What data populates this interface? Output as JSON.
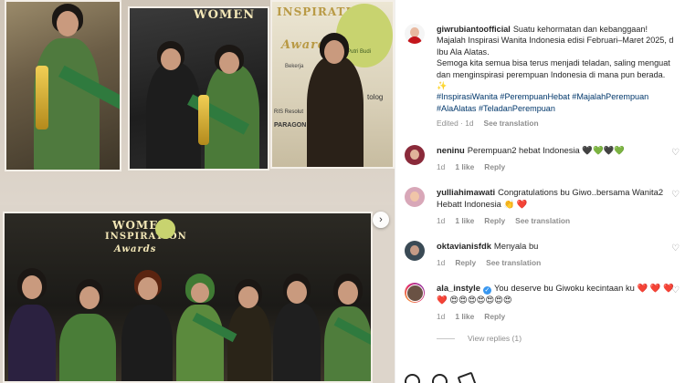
{
  "post": {
    "author": "giwrubiantoofficial",
    "caption_lines": [
      "Suatu kehormatan dan kebanggaan!",
      "Majalah Inspirasi Wanita Indonesia edisi Februari–Maret 2025, d",
      "Ibu Ala Alatas.",
      "Semoga kita semua bisa terus menjadi teladan, saling menguat",
      "dan menginspirasi perempuan Indonesia di mana pun berada.",
      "✨"
    ],
    "hashtags_line1": "#InspirasiWanita #PerempuanHebat #MajalahPerempuan",
    "hashtags_line2": "#AlaAlatas #TeladanPerempuan",
    "edited": "Edited · 1d",
    "see_translation": "See translation"
  },
  "photo": {
    "banner_top": "WOMEN",
    "banner_top2": "INSPIRATION",
    "banner_award": "Awards",
    "banner_bottom": "WOMEN",
    "banner_bottom2": "INSPIRATION",
    "banner_bottom_award": "Awards",
    "sponsor1": "Bekerja",
    "sponsor2": "RIS Resolut",
    "sponsor3": "PARAGON",
    "sponsor4": "tolog",
    "logo_text": "Putri Budi",
    "next_icon": "chevron-right-icon"
  },
  "comments": [
    {
      "user": "neninu",
      "text": "Perempuan2 hebat Indonesia 🖤💚🖤💚",
      "time": "1d",
      "likes": "1 like",
      "reply": "Reply",
      "translate": ""
    },
    {
      "user": "yulliahimawati",
      "text": "Congratulations bu Giwo..bersama Wanita2 Hebatt Indonesia 👏 ❤️",
      "time": "1d",
      "likes": "1 like",
      "reply": "Reply",
      "translate": "See translation"
    },
    {
      "user": "oktavianisfdk",
      "text": "Menyala bu",
      "time": "1d",
      "likes": "",
      "reply": "Reply",
      "translate": "See translation"
    },
    {
      "user": "ala_instyle",
      "text": "You deserve bu Giwoku kecintaan ku ❤️ ❤️ ❤️",
      "text2": "❤️ 😍😍😍😍😍😍😍",
      "time": "1d",
      "likes": "1 like",
      "reply": "Reply",
      "translate": ""
    }
  ],
  "view_replies": "View replies (1)",
  "colors": {
    "hashtag": "#00376b",
    "meta": "#8e8e8e",
    "heart": "#ed4956",
    "verified": "#3897f0"
  }
}
